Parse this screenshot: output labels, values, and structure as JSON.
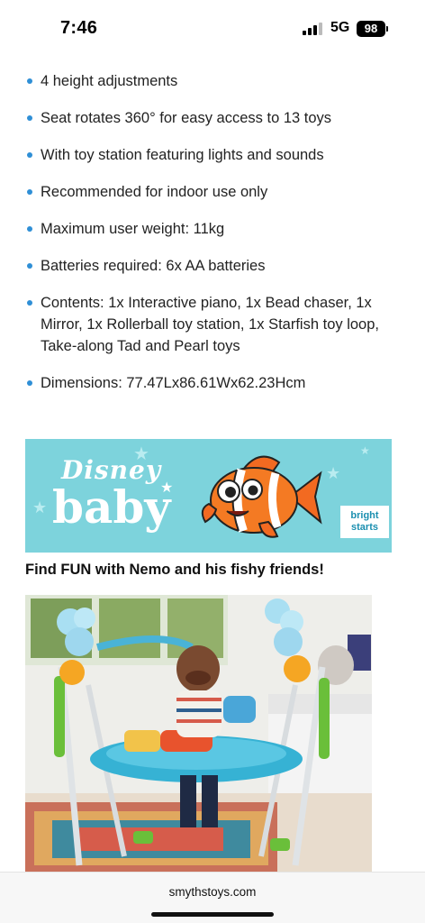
{
  "status_bar": {
    "time": "7:46",
    "network": "5G",
    "battery": "98"
  },
  "specs": [
    "4 height adjustments",
    "Seat rotates 360° for easy access to 13 toys",
    "With toy station featuring lights and sounds",
    "Recommended for indoor use only",
    "Maximum user weight: 11kg",
    "Batteries required: 6x AA batteries",
    "Contents: 1x Interactive piano, 1x Bead chaser, 1x Mirror, 1x Rollerball toy station, 1x Starfish toy loop, Take-along Tad and Pearl toys",
    "Dimensions: 77.47Lx86.61Wx62.23Hcm"
  ],
  "banner": {
    "logo_top": "Disney",
    "logo_bottom": "baby",
    "brand_line1": "bright",
    "brand_line2": "starts",
    "background_color": "#7dd3dc"
  },
  "headline": "Find FUN with Nemo and his fishy friends!",
  "url_bar": {
    "domain": "smythstoys.com"
  }
}
